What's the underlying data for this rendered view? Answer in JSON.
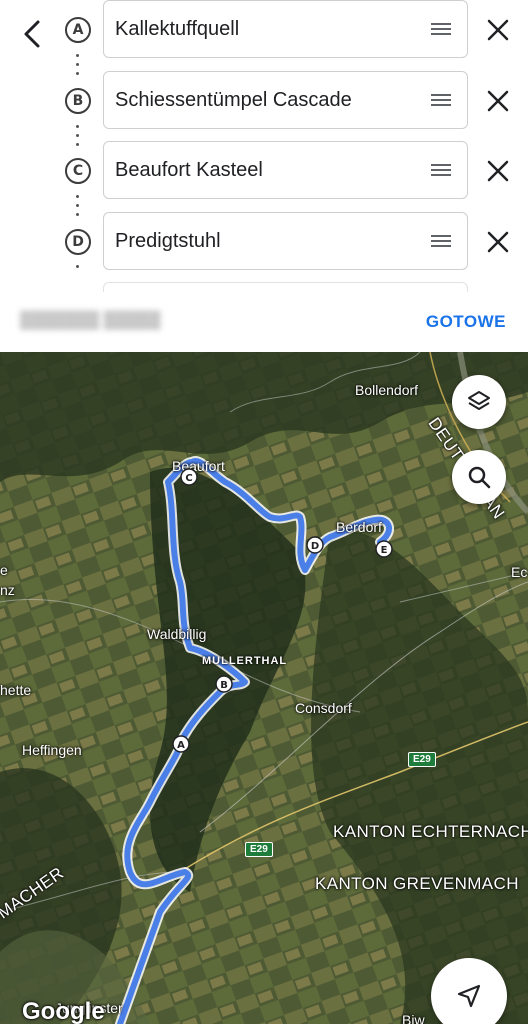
{
  "header": {
    "back_icon": "chevron-left-icon"
  },
  "stops": [
    {
      "letter": "A",
      "name": "Kallektuffquell"
    },
    {
      "letter": "B",
      "name": "Schiessentümpel Cascade"
    },
    {
      "letter": "C",
      "name": "Beaufort Kasteel"
    },
    {
      "letter": "D",
      "name": "Predigtstuhl"
    }
  ],
  "actions": {
    "done_label": "GOTOWE"
  },
  "map": {
    "labels": {
      "bollendorf": "Bollendorf",
      "beaufort": "Beaufort",
      "berdorf": "Berdorf",
      "waldbillig": "Waldbillig",
      "mullerthal": "MULLERTHAL",
      "consdorf": "Consdorf",
      "heffingen": "Heffingen",
      "hette": "hette",
      "e_left": "e",
      "nz": "nz",
      "ec": "Ec",
      "kanton_echternach": "KANTON ECHTERNACH",
      "kanton_grevenmacher": "KANTON GREVENMACH",
      "macher": "MACHER",
      "junglinster": "Junglinster",
      "deutschland": "DEUTSCHLAN",
      "biw": "Biw"
    },
    "markers": {
      "a": "A",
      "b": "B",
      "c": "C",
      "d": "D",
      "e": "E"
    },
    "road_badges": {
      "e29_upper": "E29",
      "e29_lower": "E29"
    },
    "logo": "Google",
    "route_color": "#4a7fe8",
    "buttons": {
      "layers_icon": "layers-icon",
      "search_icon": "search-icon",
      "navigate_icon": "navigation-arrow-icon"
    }
  }
}
